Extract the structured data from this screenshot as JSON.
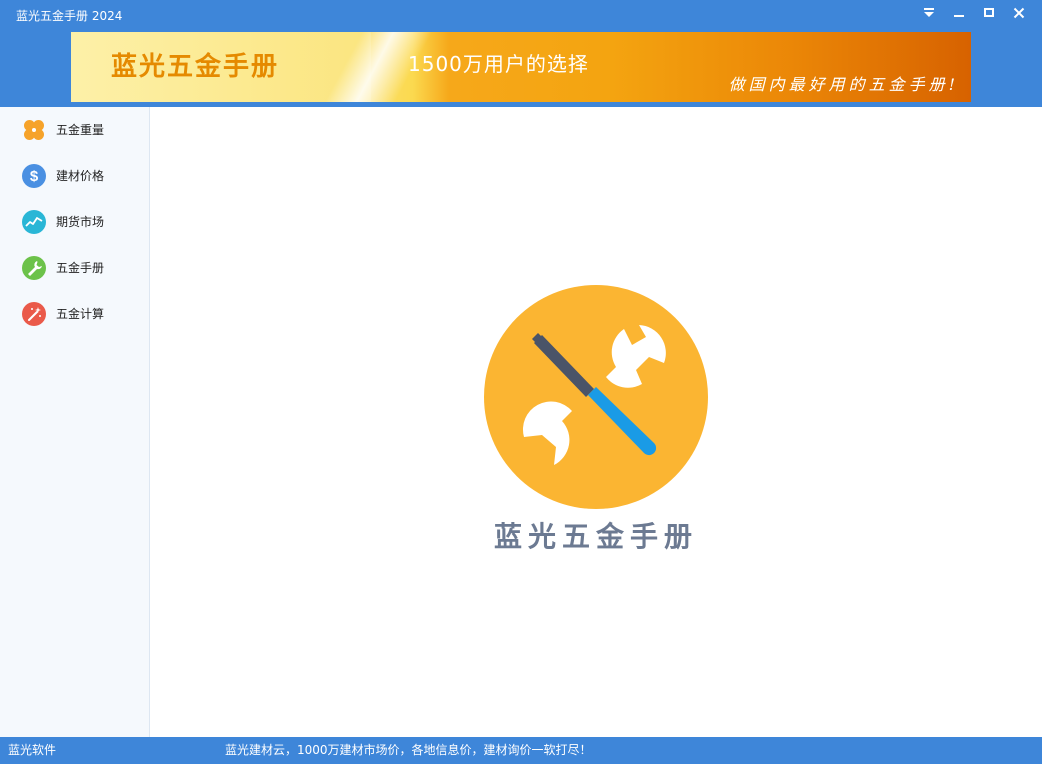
{
  "window": {
    "title": "蓝光五金手册 2024",
    "controls": [
      "menu-icon",
      "minimize-icon",
      "maximize-icon",
      "close-icon"
    ]
  },
  "banner": {
    "title": "蓝光五金手册",
    "slogan": "1500万用户的选择",
    "tagline": "做国内最好用的五金手册!"
  },
  "sidebar": {
    "items": [
      {
        "label": "五金重量",
        "icon": "clover-icon",
        "color": "#f6a32a"
      },
      {
        "label": "建材价格",
        "icon": "dollar-icon",
        "color": "#4a90e2"
      },
      {
        "label": "期货市场",
        "icon": "trend-chart-icon",
        "color": "#29b6d6"
      },
      {
        "label": "五金手册",
        "icon": "wrench-icon",
        "color": "#6cc24a"
      },
      {
        "label": "五金计算",
        "icon": "magic-wand-icon",
        "color": "#ea5a4a"
      }
    ]
  },
  "main": {
    "logo_icon": "wrench-screwdriver-icon",
    "logo_text": "蓝光五金手册"
  },
  "statusbar": {
    "left": "蓝光软件",
    "message": "蓝光建材云，1000万建材市场价，各地信息价，建材询价一软打尽！"
  },
  "colors": {
    "accent": "#3e86d9",
    "logo_circle": "#fbb532",
    "logo_text": "#6c7a92"
  }
}
